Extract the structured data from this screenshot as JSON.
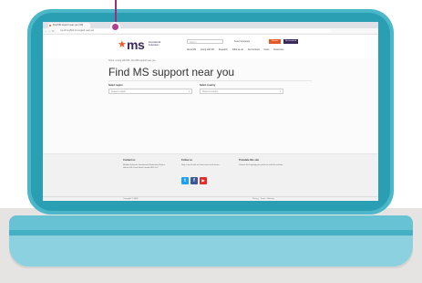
{
  "browser": {
    "tab_title": "Find MS support near you | MS",
    "address": "ms-intl.org/find-ms-support-near-you",
    "nav_back": "←",
    "nav_forward": "→",
    "nav_reload": "↻"
  },
  "header": {
    "logo_star": "★",
    "logo_text": "ms",
    "logo_subtitle": "International Federation",
    "search_placeholder": "Search",
    "language": "Select language",
    "donate_label": "Donate",
    "join_label": "Get involved",
    "nav_items": [
      "About MS",
      "Living with MS",
      "Research",
      "What we do",
      "Get involved",
      "News",
      "Resources"
    ]
  },
  "breadcrumb": "Home › Living with MS › Find MS support near you",
  "page_title": "Find MS support near you",
  "filters": {
    "region_label": "Select region",
    "region_placeholder": "Select a region",
    "country_label": "Select country",
    "country_placeholder": "Select a country",
    "chevron": "▾"
  },
  "footer": {
    "contact_title": "Contact us",
    "contact_text": "Multiple Sclerosis International Federation Skyline House 200 Union Street London SE1 0LX",
    "follow_title": "Follow us",
    "follow_text": "Stay in touch with our latest news and stories",
    "translate_title": "Translate this site",
    "translate_text": "Choose the language you prefer to read this website",
    "social_twitter": "t",
    "social_facebook": "f",
    "social_youtube": "▶",
    "bottom_left": "Copyright © MSIF",
    "bottom_right": "Privacy · Terms · Sitemap"
  },
  "colors": {
    "laptop": "#4cb7c9",
    "accent_orange": "#e35b2b",
    "brand_purple": "#3b2b5c",
    "pointer": "#b23e94"
  }
}
